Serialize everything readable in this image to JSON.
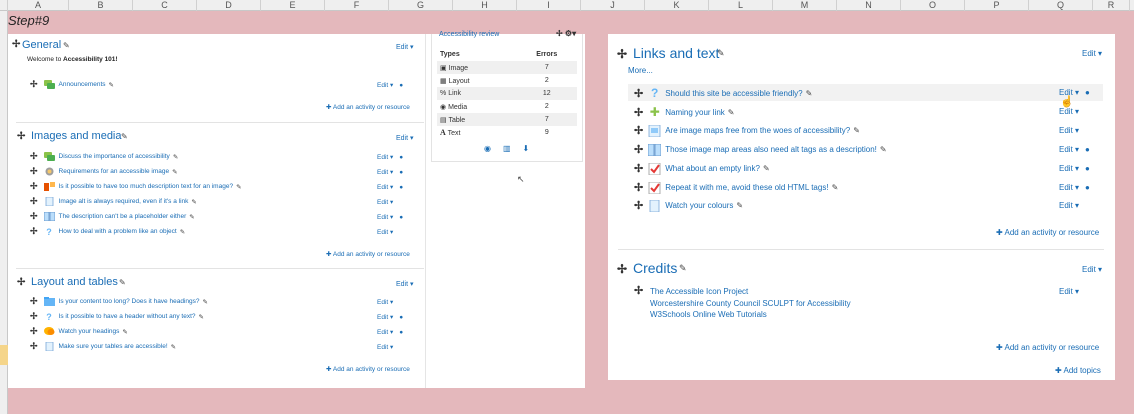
{
  "spreadsheet": {
    "columns": [
      "A",
      "B",
      "C",
      "D",
      "E",
      "F",
      "G",
      "H",
      "I",
      "J",
      "K",
      "L",
      "M",
      "N",
      "O",
      "P",
      "Q",
      "R"
    ],
    "step_label": "Step#9"
  },
  "left": {
    "general": {
      "title": "General",
      "edit": "Edit",
      "welcome_prefix": "Welcome to ",
      "welcome_bold": "Accessibility 101!",
      "items": [
        {
          "label": "Announcements",
          "edit": "Edit"
        }
      ],
      "add": "Add an activity or resource"
    },
    "images": {
      "title": "Images and media",
      "edit": "Edit",
      "items": [
        {
          "label": "Discuss the importance of accessibility",
          "edit": "Edit"
        },
        {
          "label": "Requirements for an accessible image",
          "edit": "Edit"
        },
        {
          "label": "Is it possible to have too much description text for an image?",
          "edit": "Edit"
        },
        {
          "label": "Image alt is always required, even if it's a link",
          "edit": "Edit"
        },
        {
          "label": "The description can't be a placeholder either",
          "edit": "Edit"
        },
        {
          "label": "How to deal with a problem like an object",
          "edit": "Edit"
        }
      ],
      "add": "Add an activity or resource"
    },
    "layout": {
      "title": "Layout and tables",
      "edit": "Edit",
      "items": [
        {
          "label": "Is your content too long? Does it have headings?",
          "edit": "Edit"
        },
        {
          "label": "Is it possible to have a header without any text?",
          "edit": "Edit"
        },
        {
          "label": "Watch your headings",
          "edit": "Edit"
        },
        {
          "label": "Make sure your tables are accessible!",
          "edit": "Edit"
        }
      ],
      "add": "Add an activity or resource"
    }
  },
  "review": {
    "title": "Accessibility review",
    "col_types": "Types",
    "col_errors": "Errors",
    "rows": [
      {
        "type": "Image",
        "errors": "7"
      },
      {
        "type": "Layout",
        "errors": "2"
      },
      {
        "type": "Link",
        "errors": "12"
      },
      {
        "type": "Media",
        "errors": "2"
      },
      {
        "type": "Table",
        "errors": "7"
      },
      {
        "type": "Text",
        "errors": "9"
      }
    ]
  },
  "right": {
    "links": {
      "title": "Links and text",
      "edit": "Edit",
      "more": "More...",
      "items": [
        {
          "label": "Should this site be accessible friendly?",
          "edit": "Edit"
        },
        {
          "label": "Naming your link",
          "edit": "Edit"
        },
        {
          "label": "Are image maps free from the woes of accessibility?",
          "edit": "Edit"
        },
        {
          "label": "Those image map areas also need alt tags as a description!",
          "edit": "Edit"
        },
        {
          "label": "What about an empty link?",
          "edit": "Edit"
        },
        {
          "label": "Repeat it with me, avoid these old HTML tags!",
          "edit": "Edit"
        },
        {
          "label": "Watch your colours",
          "edit": "Edit"
        }
      ],
      "add": "Add an activity or resource"
    },
    "credits": {
      "title": "Credits",
      "edit": "Edit",
      "item_edit": "Edit",
      "lines": [
        "The Accessible Icon Project",
        "Worcestershire County Council SCULPT for Accessibility",
        "W3Schools Online Web Tutorials"
      ],
      "add": "Add an activity or resource",
      "add_topics": "Add topics"
    }
  },
  "colors": {
    "link": "#1a6db5",
    "background": "#e4b8bc"
  }
}
